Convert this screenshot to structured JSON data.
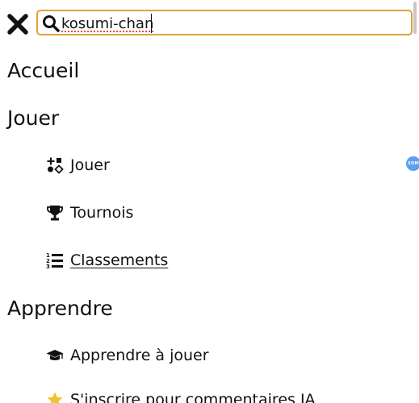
{
  "search": {
    "value": "kosumi-chan",
    "placeholder": ""
  },
  "icons": {
    "close": "close-icon",
    "search": "search-icon"
  },
  "colors": {
    "search_border": "#e1a23a",
    "badge": "#5aa0f0",
    "star": "#f2c230"
  },
  "sections": [
    {
      "heading": "Accueil",
      "items": []
    },
    {
      "heading": "Jouer",
      "items": [
        {
          "label": "Jouer",
          "icon": "game-pieces-icon"
        },
        {
          "label": "Tournois",
          "icon": "trophy-icon"
        },
        {
          "label": "Classements",
          "icon": "ordered-list-icon"
        }
      ]
    },
    {
      "heading": "Apprendre",
      "items": [
        {
          "label": "Apprendre à jouer",
          "icon": "graduation-cap-icon"
        },
        {
          "label": "S'inscrire pour commentaires IA",
          "icon": "star-icon"
        }
      ]
    }
  ],
  "badge": {
    "text": "SOM"
  }
}
